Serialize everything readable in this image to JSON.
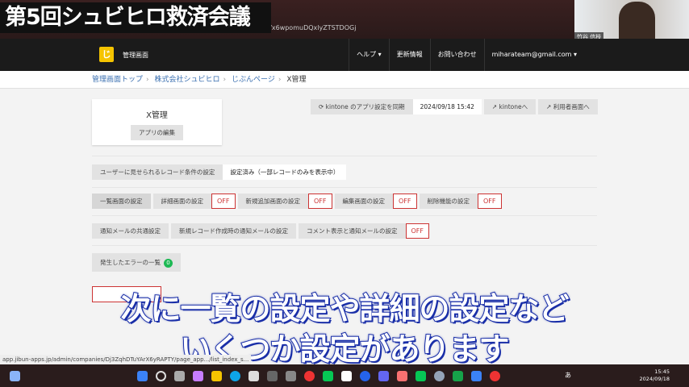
{
  "video_title": "第5回シュビヒロ救済会議",
  "browser": {
    "url_fragment": "s/x6wpomuDQxlyZTSTDOGj"
  },
  "webcam": {
    "name": "竹谷 信枝"
  },
  "nav": {
    "brand": "管理画面",
    "logo_char": "じ",
    "menu": [
      "ヘルプ ▾",
      "更新情報",
      "お問い合わせ",
      "miharateam@gmail.com ▾"
    ]
  },
  "breadcrumb": [
    "管理画面トップ",
    "株式会社シュビヒロ",
    "じぶんページ",
    "X管理"
  ],
  "app": {
    "title": "X管理",
    "edit_label": "アプリの編集"
  },
  "sync": {
    "label": "⟳ kintone のアプリ設定を同期",
    "timestamp": "2024/09/18 15:42",
    "kintone_link": "kintoneへ",
    "user_link": "利用者画面へ"
  },
  "record_condition": {
    "label": "ユーザーに見せられるレコード条件の設定",
    "value": "設定済み（一部レコードのみを表示中）"
  },
  "screens": [
    {
      "label": "一覧画面の設定"
    },
    {
      "label": "詳細画面の設定",
      "status": "OFF"
    },
    {
      "label": "新規追加画面の設定",
      "status": "OFF"
    },
    {
      "label": "編集画面の設定",
      "status": "OFF"
    },
    {
      "label": "削除機能の設定",
      "status": "OFF"
    }
  ],
  "mail": [
    {
      "label": "通知メールの共通設定"
    },
    {
      "label": "新規レコード作成時の通知メールの設定"
    },
    {
      "label": "コメント表示と通知メールの設定",
      "status": "OFF"
    }
  ],
  "errors": {
    "label": "発生したエラーの一覧",
    "count": "0"
  },
  "subtitle": {
    "line1": "次に一覧の設定や詳細の設定など",
    "line2": "いくつか設定があります"
  },
  "status_url": "app.jibun-apps.jp/admin/companies/Dj3ZqhDTuYArX6yRAPTY/page_app.../list_index_s...",
  "taskbar": {
    "time": "15:45",
    "date": "2024/09/18",
    "ime": "あ"
  },
  "colors": {
    "off": "#cc3333",
    "badge": "#1db954",
    "logo": "#f5c400",
    "link": "#3a6fb0"
  }
}
